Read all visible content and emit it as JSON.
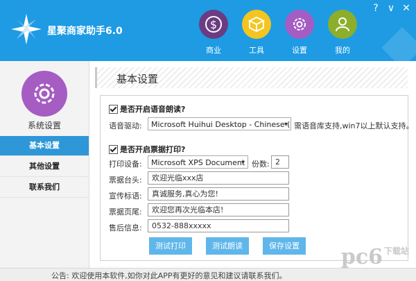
{
  "app": {
    "title": "星聚商家助手6.0"
  },
  "window_controls": {
    "help": "?",
    "minimize": "∨",
    "close": "✕"
  },
  "top_nav": [
    {
      "label": "商业",
      "icon": "dollar-icon",
      "color": "#6b3c82"
    },
    {
      "label": "工具",
      "icon": "toolbox-icon",
      "color": "#f4c51e"
    },
    {
      "label": "设置",
      "icon": "gear-icon",
      "color": "#a55cc3"
    },
    {
      "label": "我的",
      "icon": "user-icon",
      "color": "#8cae2a"
    }
  ],
  "sidebar": {
    "title": "系统设置",
    "items": [
      {
        "label": "基本设置",
        "active": true
      },
      {
        "label": "其他设置",
        "active": false
      },
      {
        "label": "联系我们",
        "active": false
      }
    ]
  },
  "section_title": "基本设置",
  "voice": {
    "checkbox_label": "是否开启语音朗读?",
    "checked": true,
    "driver_label": "语音驱动:",
    "driver_value": "Microsoft Huihui Desktop - Chinese (",
    "driver_hint": "需语音库支持,win7以上默认支持。"
  },
  "print": {
    "checkbox_label": "是否开启票据打印?",
    "checked": true,
    "device_label": "打印设备:",
    "device_value": "Microsoft XPS Document",
    "copies_label": "份数:",
    "copies_value": "2",
    "fields": [
      {
        "label": "票据台头:",
        "value": "欢迎光临xxx店"
      },
      {
        "label": "宣传标语:",
        "value": "真诚服务,真心为您!"
      },
      {
        "label": "票据页尾:",
        "value": "欢迎您再次光临本店!"
      },
      {
        "label": "售后信息:",
        "value": "0532-888xxxxx"
      }
    ]
  },
  "buttons": {
    "test_print": "测试打印",
    "test_read": "测试朗读",
    "save": "保存设置"
  },
  "footer": {
    "notice": "公告: 欢迎使用本软件,如你对此APP有更好的意见和建议请联系我们。"
  },
  "watermark": {
    "brand": "pc6",
    "sub": "下载站"
  },
  "colors": {
    "header": "#1e9be3",
    "active_tab": "#2d97d8",
    "button": "#5fb6ea"
  }
}
